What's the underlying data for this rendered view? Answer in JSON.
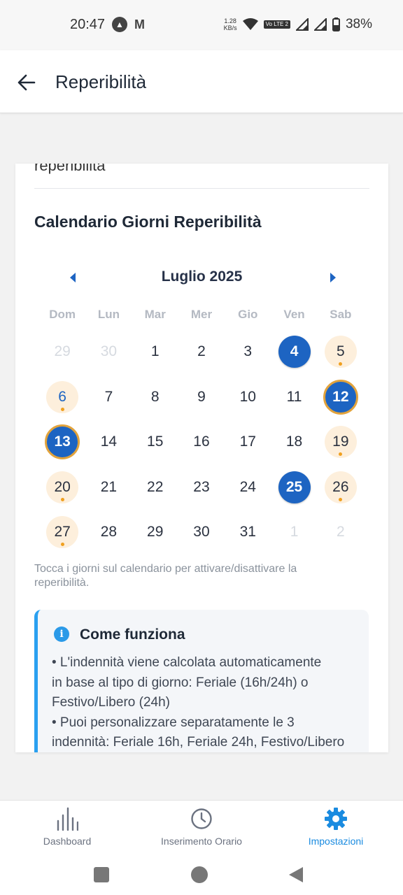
{
  "status_bar": {
    "time": "20:47",
    "left_icons": [
      "navigation-app-icon",
      "gmail-icon"
    ],
    "speed": "1.28",
    "speed_unit": "KB/s",
    "volte": "Vo LTE 2",
    "battery": "38%"
  },
  "app_bar": {
    "title": "Reperibilità"
  },
  "card": {
    "cut_text": "reperibilità",
    "section_title": "Calendario Giorni Reperibilità",
    "month": "Luglio 2025",
    "weekdays": [
      "Dom",
      "Lun",
      "Mar",
      "Mer",
      "Gio",
      "Ven",
      "Sab"
    ],
    "weeks": [
      [
        {
          "d": "29",
          "t": "muted"
        },
        {
          "d": "30",
          "t": "muted"
        },
        {
          "d": "1",
          "t": "normal"
        },
        {
          "d": "2",
          "t": "normal"
        },
        {
          "d": "3",
          "t": "normal"
        },
        {
          "d": "4",
          "t": "selected"
        },
        {
          "d": "5",
          "t": "holiday"
        }
      ],
      [
        {
          "d": "6",
          "t": "holiday-blue"
        },
        {
          "d": "7",
          "t": "normal"
        },
        {
          "d": "8",
          "t": "normal"
        },
        {
          "d": "9",
          "t": "normal"
        },
        {
          "d": "10",
          "t": "normal"
        },
        {
          "d": "11",
          "t": "normal"
        },
        {
          "d": "12",
          "t": "selected-ring"
        }
      ],
      [
        {
          "d": "13",
          "t": "selected-ring"
        },
        {
          "d": "14",
          "t": "normal"
        },
        {
          "d": "15",
          "t": "normal"
        },
        {
          "d": "16",
          "t": "normal"
        },
        {
          "d": "17",
          "t": "normal"
        },
        {
          "d": "18",
          "t": "normal"
        },
        {
          "d": "19",
          "t": "holiday"
        }
      ],
      [
        {
          "d": "20",
          "t": "holiday"
        },
        {
          "d": "21",
          "t": "normal"
        },
        {
          "d": "22",
          "t": "normal"
        },
        {
          "d": "23",
          "t": "normal"
        },
        {
          "d": "24",
          "t": "normal"
        },
        {
          "d": "25",
          "t": "selected"
        },
        {
          "d": "26",
          "t": "holiday"
        }
      ],
      [
        {
          "d": "27",
          "t": "holiday"
        },
        {
          "d": "28",
          "t": "normal"
        },
        {
          "d": "29",
          "t": "normal"
        },
        {
          "d": "30",
          "t": "normal"
        },
        {
          "d": "31",
          "t": "normal"
        },
        {
          "d": "1",
          "t": "muted"
        },
        {
          "d": "2",
          "t": "muted"
        }
      ]
    ],
    "hint": "Tocca i giorni sul calendario per attivare/disattivare la reperibilità.",
    "info": {
      "title": "Come funziona",
      "lines": [
        "• L'indennità viene calcolata automaticamente",
        "in base al tipo di giorno: Feriale (16h/24h) o",
        "Festivo/Libero (24h)",
        "• Puoi personalizzare separatamente le 3",
        "indennità: Feriale 16h, Feriale 24h, Festivo/Libero"
      ]
    }
  },
  "bottom_nav": {
    "items": [
      {
        "label": "Dashboard",
        "icon": "chart-icon"
      },
      {
        "label": "Inserimento Orario",
        "icon": "clock-icon"
      },
      {
        "label": "Impostazioni",
        "icon": "gear-icon"
      }
    ],
    "active": "Impostazioni"
  },
  "colors": {
    "primary": "#1d64c2",
    "accent": "#1a8be0",
    "holiday_bg": "#fdefdc",
    "holiday_dot": "#f0a020",
    "ring": "#e2a33c"
  }
}
